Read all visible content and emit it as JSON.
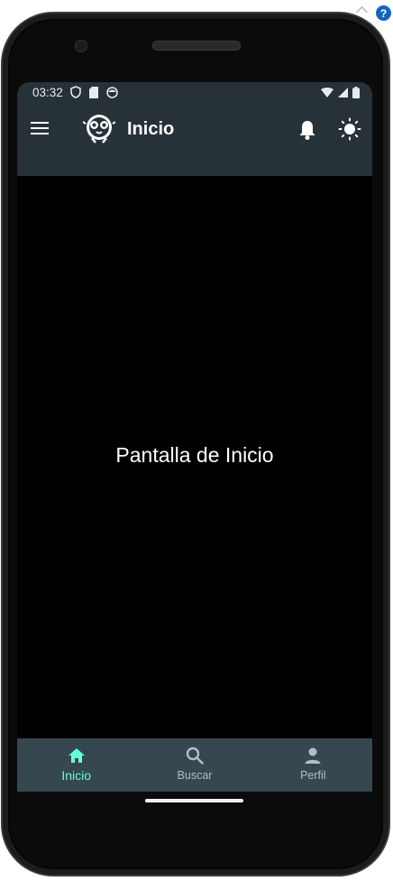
{
  "help_badge": "?",
  "status_bar": {
    "time": "03:32"
  },
  "app_bar": {
    "title": "Inicio",
    "icons": [
      "menu-icon",
      "logo-icon",
      "bell-icon",
      "brightness-icon"
    ]
  },
  "content": {
    "text": "Pantalla de Inicio"
  },
  "bottom_nav": {
    "items": [
      {
        "label": "Inicio",
        "icon": "home-icon",
        "active": true
      },
      {
        "label": "Buscar",
        "icon": "search-icon",
        "active": false
      },
      {
        "label": "Perfil",
        "icon": "person-icon",
        "active": false
      }
    ]
  },
  "colors": {
    "app_bar": "#263238",
    "bottom_nav": "#37474f",
    "accent": "#64ffda",
    "inactive": "#b0bec5",
    "background": "#000000"
  }
}
